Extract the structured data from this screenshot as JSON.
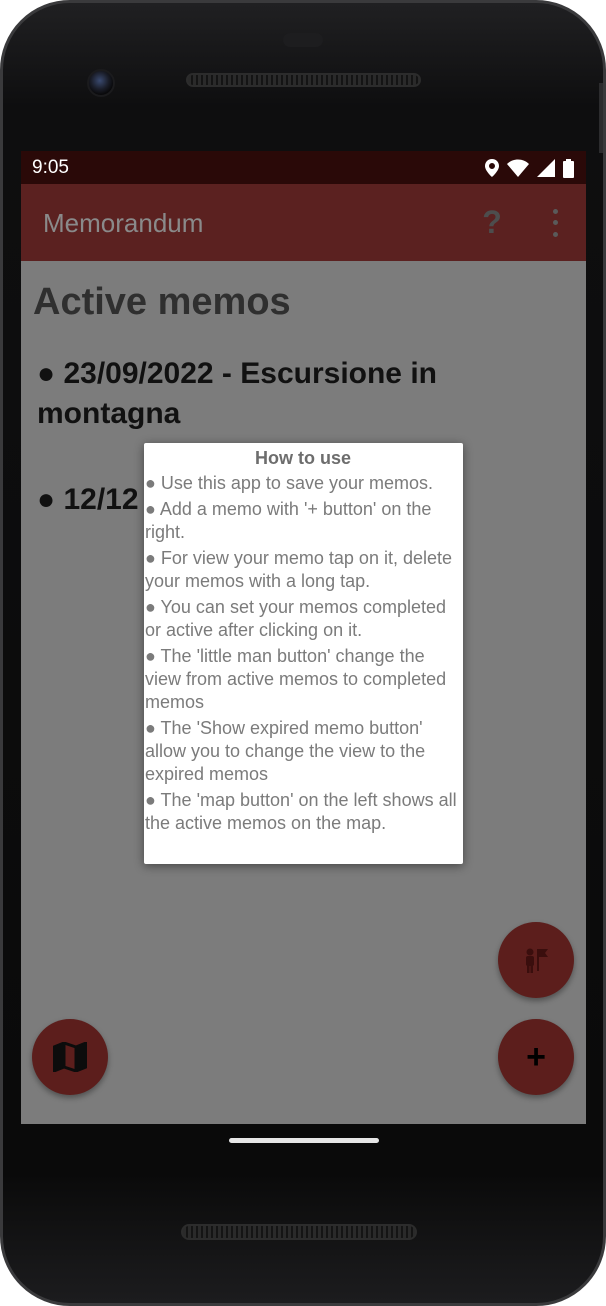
{
  "status_bar": {
    "time": "9:05",
    "icons": [
      "location-icon",
      "wifi-icon",
      "signal-icon",
      "battery-icon"
    ]
  },
  "toolbar": {
    "title": "Memorandum",
    "help_label": "?",
    "overflow_icon": "more-vert-icon"
  },
  "main": {
    "heading": "Active memos",
    "memos": [
      "● 23/09/2022 - Escursione in montagna",
      "● 12/12"
    ]
  },
  "dialog": {
    "title": "How to use",
    "lines": [
      "● Use this app to save your memos.",
      " ● Add a memo with '+ button' on the right.",
      " ● For view your memo tap on it, delete your memos with a long tap.",
      " ● You can set your memos completed or active after clicking on it.",
      " ● The 'little man button' change the view from active memos to completed memos",
      " ● The 'Show expired memo button' allow you to change the view to the expired memos",
      " ● The 'map button' on the left shows all the active memos on the map."
    ]
  },
  "fabs": {
    "map_icon": "map-icon",
    "person_icon": "person-flag-icon",
    "add_label": "+"
  },
  "colors": {
    "status_bar": "#2a0908",
    "toolbar": "#5b2120",
    "scrim_background": "#7c7c7c",
    "fab": "#5c1e1c",
    "dialog_background": "#ffffff"
  }
}
